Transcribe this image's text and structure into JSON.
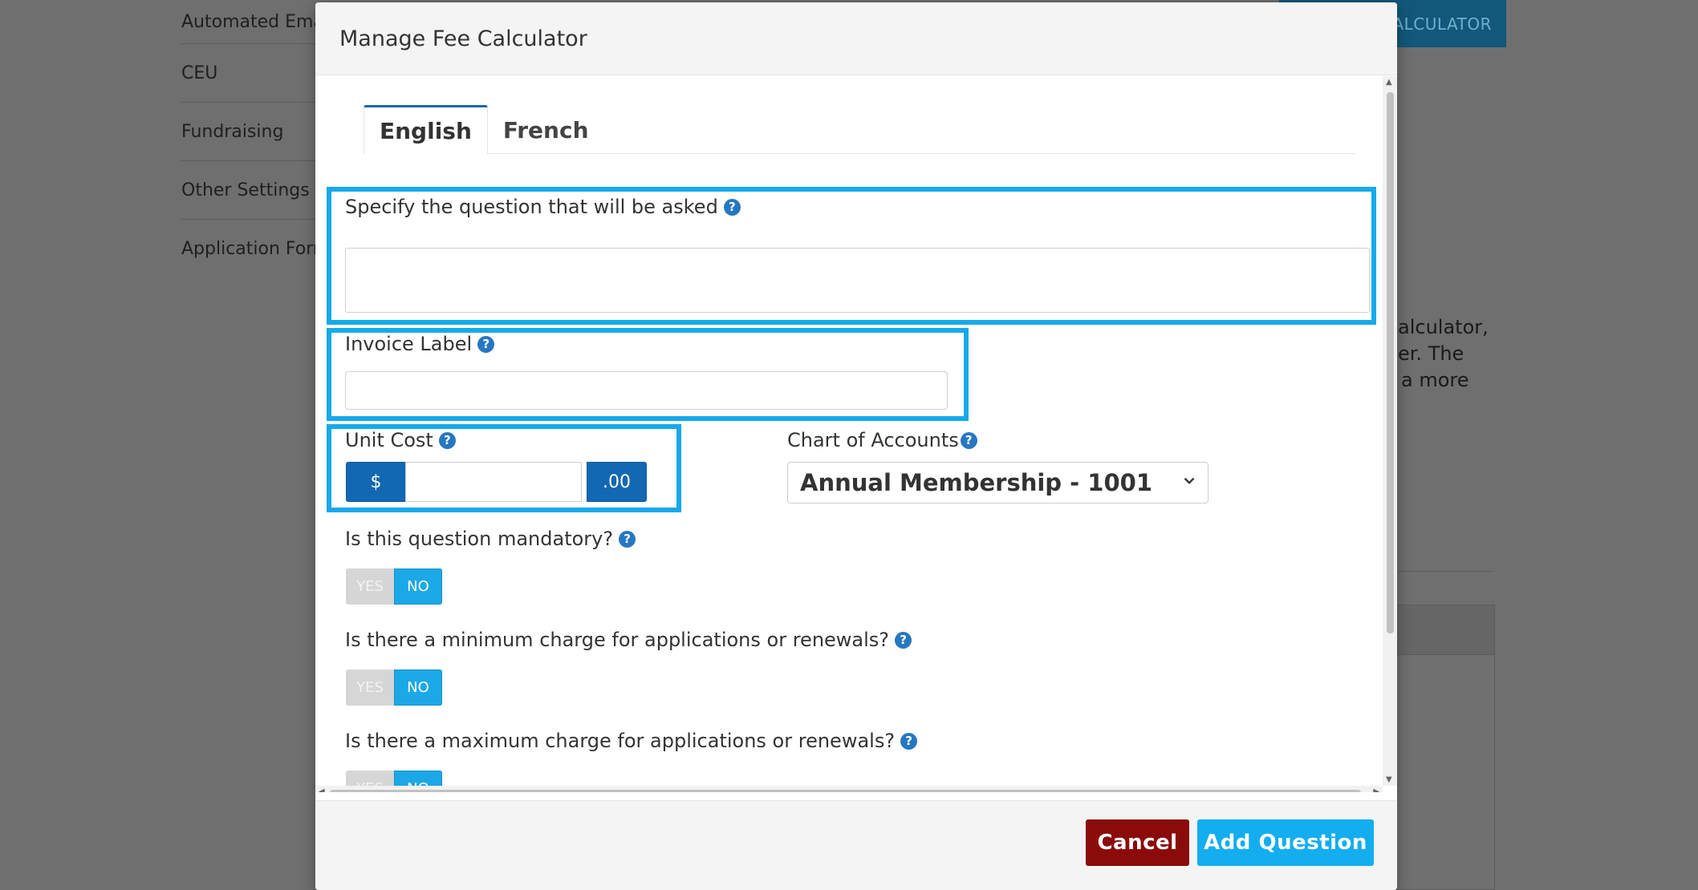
{
  "background": {
    "sidebar_items": [
      {
        "label": "Automated Emails"
      },
      {
        "label": "CEU"
      },
      {
        "label": "Fundraising"
      },
      {
        "label": "Other Settings"
      },
      {
        "label": "Application Form"
      }
    ],
    "top_button_label": "CALCULATOR",
    "paragraph_lines": [
      "alculator,",
      "er. The",
      "a more"
    ]
  },
  "modal": {
    "title": "Manage Fee Calculator",
    "tabs": [
      {
        "label": "English",
        "active": true
      },
      {
        "label": "French",
        "active": false
      }
    ],
    "question_field": {
      "label": "Specify the question that will be asked",
      "value": "",
      "placeholder": ""
    },
    "invoice_label_field": {
      "label": "Invoice Label",
      "value": "",
      "placeholder": ""
    },
    "unit_cost": {
      "label": "Unit Cost",
      "prefix": "$",
      "suffix": ".00",
      "value": ""
    },
    "chart_of_accounts": {
      "label": "Chart of Accounts",
      "selected": "Annual Membership - 1001"
    },
    "mandatory": {
      "label": "Is this question mandatory?",
      "yes": "YES",
      "no": "NO",
      "value": "NO"
    },
    "minimum_charge": {
      "label": "Is there a minimum charge for applications or renewals?",
      "yes": "YES",
      "no": "NO",
      "value": "NO"
    },
    "maximum_charge": {
      "label": "Is there a maximum charge for applications or renewals?",
      "yes": "YES",
      "no": "NO",
      "value": "NO"
    },
    "help_glyph": "?",
    "footer": {
      "cancel_label": "Cancel",
      "add_label": "Add Question"
    }
  },
  "colors": {
    "primary_blue": "#1268b3",
    "highlight": "#17a9ea",
    "toggle_active": "#1ca8e6",
    "cancel_red": "#8b0b0b",
    "add_button": "#13adf0"
  }
}
